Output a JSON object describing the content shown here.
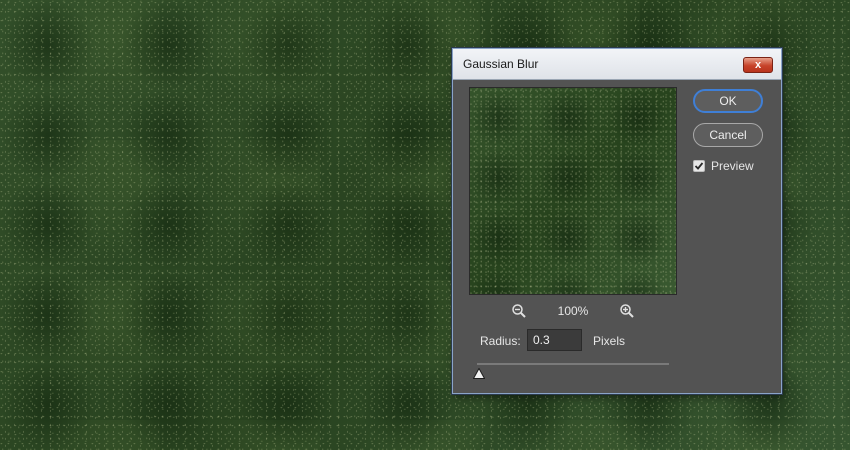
{
  "dialog": {
    "title": "Gaussian Blur",
    "close_label": "x",
    "ok_label": "OK",
    "cancel_label": "Cancel",
    "preview_checkbox_label": "Preview",
    "preview_checked": true,
    "zoom_level": "100%",
    "radius_label": "Radius:",
    "radius_value": "0.3",
    "radius_units": "Pixels",
    "radius_slider_fraction": 0.01,
    "icons": {
      "zoom_out": "zoom-out-icon",
      "zoom_in": "zoom-in-icon",
      "check": "check-icon",
      "slider_thumb": "slider-thumb-icon"
    }
  },
  "colors": {
    "dialog_bg": "#535353",
    "ok_focus_ring": "#3f7fd6",
    "close_button": "#c7432a"
  }
}
